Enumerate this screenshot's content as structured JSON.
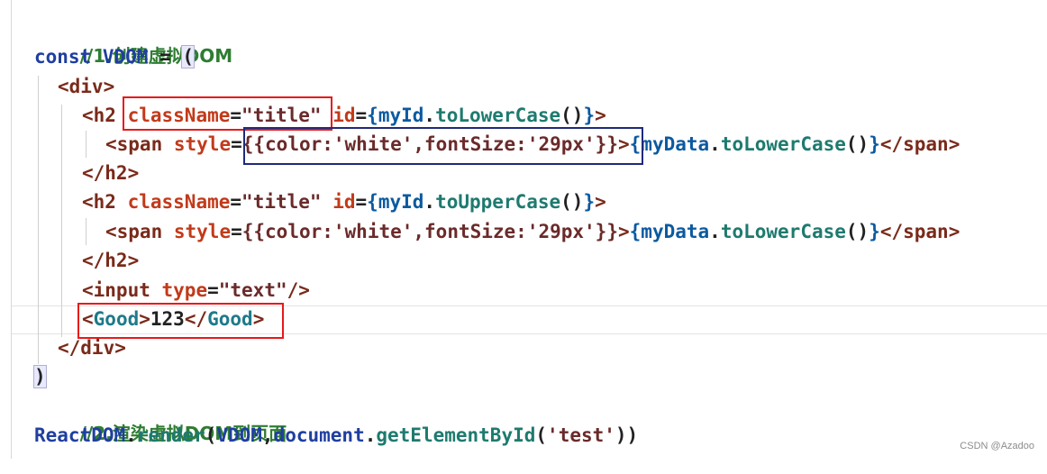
{
  "comment_create": "//1.创建虚拟DOM",
  "comment_render": "//2.渲染虚拟DOM到页面",
  "line_const": {
    "kw": "const",
    "var": "VDOM",
    "eq": " = ",
    "paren": "("
  },
  "line_div_open": {
    "tag": "<div>"
  },
  "line_h2_1": {
    "open": "<h2",
    "attr1": "className",
    "eq1": "=",
    "str1": "\"title\"",
    "attr2": "id",
    "eq2": "=",
    "brace_open": "{",
    "obj": "myId",
    "dot": ".",
    "method": "toLowerCase",
    "call": "()",
    "brace_close": "}",
    "close": ">"
  },
  "line_span_1": {
    "open": "<span",
    "attr": "style",
    "eq": "=",
    "style_value": "{{color:'white',fontSize:'29px'}}",
    "close": ">",
    "brace_open": "{",
    "obj": "myData",
    "dot": ".",
    "method": "toLowerCase",
    "call": "()",
    "brace_close": "}",
    "end": "</span>"
  },
  "line_h2_close_1": {
    "tag": "</h2>"
  },
  "line_h2_2": {
    "open": "<h2",
    "attr1": "className",
    "eq1": "=",
    "str1": "\"title\"",
    "attr2": "id",
    "eq2": "=",
    "brace_open": "{",
    "obj": "myId",
    "dot": ".",
    "method": "toUpperCase",
    "call": "()",
    "brace_close": "}",
    "close": ">"
  },
  "line_span_2": {
    "open": "<span",
    "attr": "style",
    "eq": "=",
    "style_value": "{{color:'white',fontSize:'29px'}}",
    "close": ">",
    "brace_open": "{",
    "obj": "myData",
    "dot": ".",
    "method": "toLowerCase",
    "call": "()",
    "brace_close": "}",
    "end": "</span>"
  },
  "line_h2_close_2": {
    "tag": "</h2>"
  },
  "line_input": {
    "open": "<input",
    "attr": "type",
    "eq": "=",
    "str": "\"text\"",
    "close": "/>"
  },
  "line_good": {
    "lt1": "<",
    "comp1": "Good",
    "gt1": ">",
    "text": "123",
    "lt2": "</",
    "comp2": "Good",
    "gt2": ">"
  },
  "line_div_close": {
    "tag": "</div>"
  },
  "line_paren_close": {
    "paren": ")"
  },
  "line_render": {
    "obj": "ReactDOM",
    "dot1": ".",
    "method": "render",
    "p_open": "(",
    "var": "VDOM",
    "comma": ",",
    "doc": "document",
    "dot2": ".",
    "method2": "getElementById",
    "p2_open": "(",
    "str": "'test'",
    "p_close": "))"
  },
  "watermark": "CSDN @Azadoo",
  "highlight_colors": {
    "red": "#e8191b",
    "blue": "#1f2a7a"
  }
}
